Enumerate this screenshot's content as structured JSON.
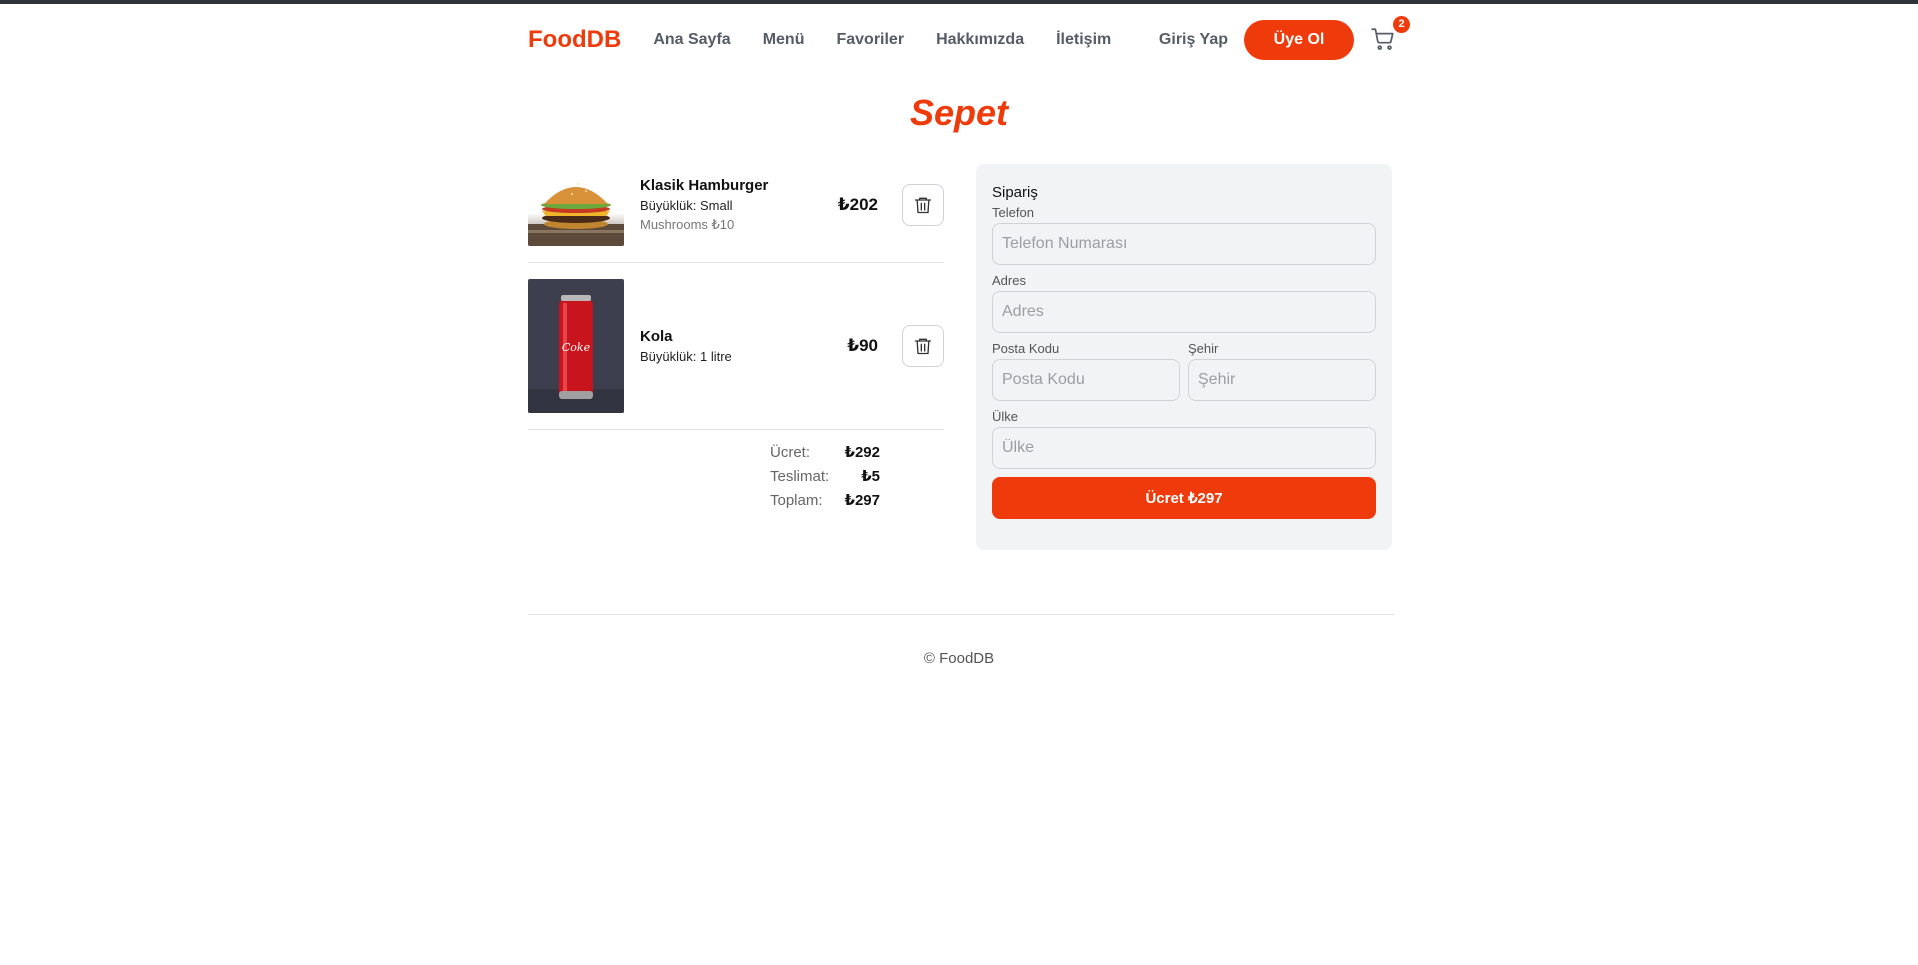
{
  "brand": "FoodDB",
  "nav": [
    "Ana Sayfa",
    "Menü",
    "Favoriler",
    "Hakkımızda",
    "İletişim"
  ],
  "auth": {
    "login": "Giriş Yap",
    "signup": "Üye Ol"
  },
  "cart": {
    "count": "2",
    "icon": "cart-icon"
  },
  "page_title": "Sepet",
  "items": [
    {
      "name": "Klasik Hamburger",
      "size": "Büyüklük: Small",
      "extra": "Mushrooms ₺10",
      "price": "₺202",
      "image": "burger"
    },
    {
      "name": "Kola",
      "size": "Büyüklük: 1 litre",
      "extra": "",
      "price": "₺90",
      "image": "cola-can"
    }
  ],
  "totals": {
    "fee_label": "Ücret:",
    "fee": "₺292",
    "delivery_label": "Teslimat:",
    "delivery": "₺5",
    "total_label": "Toplam:",
    "total": "₺297"
  },
  "order": {
    "title": "Sipariş",
    "phone_label": "Telefon",
    "phone_placeholder": "Telefon Numarası",
    "address_label": "Adres",
    "address_placeholder": "Adres",
    "zip_label": "Posta Kodu",
    "zip_placeholder": "Posta Kodu",
    "city_label": "Şehir",
    "city_placeholder": "Şehir",
    "country_label": "Ülke",
    "country_placeholder": "Ülke",
    "pay_button": "Ücret ₺297"
  },
  "footer": "© FoodDB",
  "colors": {
    "accent": "#ef3b0c",
    "panel": "#f2f3f4"
  }
}
